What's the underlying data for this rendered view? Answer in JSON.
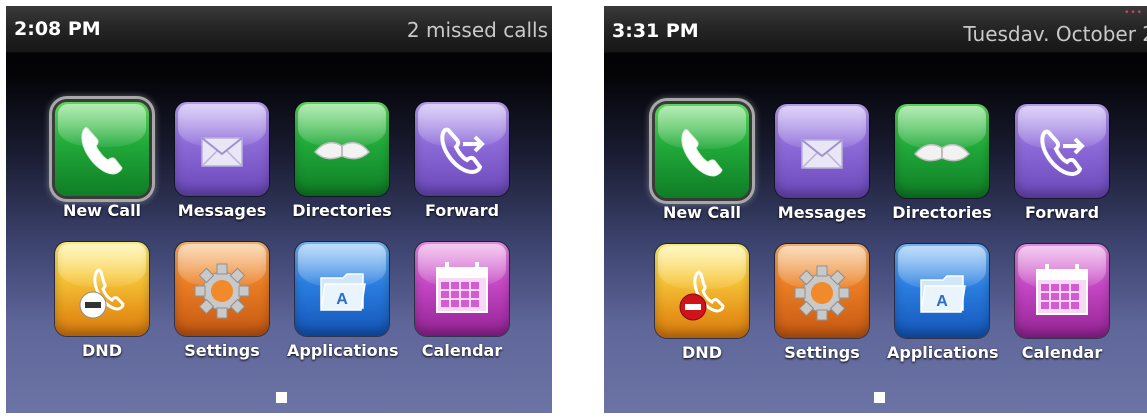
{
  "screens": [
    {
      "time": "2:08 PM",
      "status_text": "2 missed calls",
      "apps": [
        {
          "label": "New Call",
          "icon": "phone-icon",
          "color": "#21a93a"
        },
        {
          "label": "Messages",
          "icon": "envelope-icon",
          "color": "#8c6ad8"
        },
        {
          "label": "Directories",
          "icon": "book-icon",
          "color": "#21a93a"
        },
        {
          "label": "Forward",
          "icon": "forward-call-icon",
          "color": "#8c6ad8"
        },
        {
          "label": "DND",
          "icon": "do-not-disturb-icon",
          "color": "#f7c93a"
        },
        {
          "label": "Settings",
          "icon": "gear-icon",
          "color": "#ea7d23"
        },
        {
          "label": "Applications",
          "icon": "applications-folder-icon",
          "color": "#2a7ee0"
        },
        {
          "label": "Calendar",
          "icon": "calendar-icon",
          "color": "#c447c3"
        }
      ]
    },
    {
      "time": "3:31 PM",
      "status_text": "Tuesdav. October 2",
      "apps": [
        {
          "label": "New Call",
          "icon": "phone-icon",
          "color": "#21a93a"
        },
        {
          "label": "Messages",
          "icon": "envelope-icon",
          "color": "#8c6ad8"
        },
        {
          "label": "Directories",
          "icon": "book-icon",
          "color": "#21a93a"
        },
        {
          "label": "Forward",
          "icon": "forward-call-icon",
          "color": "#8c6ad8"
        },
        {
          "label": "DND",
          "icon": "do-not-disturb-icon",
          "color": "#f7c93a"
        },
        {
          "label": "Settings",
          "icon": "gear-icon",
          "color": "#ea7d23"
        },
        {
          "label": "Applications",
          "icon": "applications-folder-icon",
          "color": "#2a7ee0"
        },
        {
          "label": "Calendar",
          "icon": "calendar-icon",
          "color": "#c447c3"
        }
      ]
    }
  ]
}
